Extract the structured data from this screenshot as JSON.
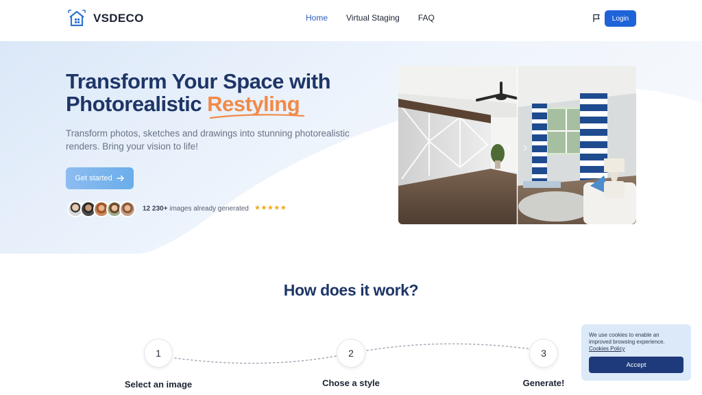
{
  "nav": {
    "brand": "VSDECO",
    "links": [
      {
        "label": "Home",
        "active": true
      },
      {
        "label": "Virtual Staging",
        "active": false
      },
      {
        "label": "FAQ",
        "active": false
      }
    ],
    "login_label": "Login",
    "icons": [
      "house-logo-icon",
      "flag-icon"
    ]
  },
  "hero": {
    "title_line1": "Transform Your Space with",
    "title_line2": "Photorealistic",
    "title_accent": "Restyling",
    "subtitle": "Transform photos, sketches and drawings into stunning photorealistic renders. Bring your vision to life!",
    "cta_label": "Get started",
    "proof_count": "12 230+",
    "proof_text": " images already generated",
    "stars": "★★★★★",
    "avatar_count": 5
  },
  "how": {
    "title": "How does it work?",
    "steps": [
      {
        "number": "1",
        "label": "Select an image"
      },
      {
        "number": "2",
        "label": "Chose a style"
      },
      {
        "number": "3",
        "label": "Generate!"
      }
    ]
  },
  "cookie": {
    "text": "We use cookies to enable an improved browsing experience.",
    "link": "Cookies Policy",
    "accept": "Accept"
  },
  "colors": {
    "primary": "#1f63d8",
    "heading": "#1e3567",
    "accent": "#f28a47",
    "cookie_bg": "#dbe9f9",
    "cookie_btn": "#1e3a7a"
  }
}
